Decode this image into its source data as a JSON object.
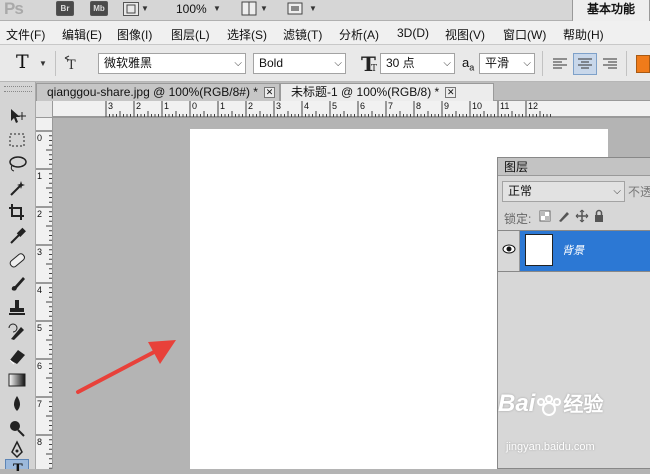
{
  "app": {
    "logo": "Ps",
    "bridge_label": "Br",
    "minibridge_label": "Mb",
    "zoom": "100%",
    "workspace": "基本功能"
  },
  "menu": [
    "文件(F)",
    "编辑(E)",
    "图像(I)",
    "图层(L)",
    "选择(S)",
    "滤镜(T)",
    "分析(A)",
    "3D(D)",
    "视图(V)",
    "窗口(W)",
    "帮助(H)"
  ],
  "options": {
    "tool_glyph": "T",
    "font_family": "微软雅黑",
    "font_style": "Bold",
    "font_size": "30 点",
    "aa_label": "a",
    "aa_sub": "a",
    "antialias": "平滑"
  },
  "tabs": [
    {
      "label": "qianggou-share.jpg @ 100%(RGB/8#) *",
      "active": false
    },
    {
      "label": "未标题-1 @ 100%(RGB/8) *",
      "active": true
    }
  ],
  "ruler_top": [
    "3",
    "2",
    "1",
    "0",
    "1",
    "2",
    "3",
    "4",
    "5",
    "6",
    "7",
    "8",
    "9",
    "10",
    "11",
    "12"
  ],
  "ruler_left": [
    "0",
    "1",
    "2",
    "3",
    "4",
    "5",
    "6",
    "7",
    "8"
  ],
  "layers": {
    "title": "图层",
    "blend_mode": "正常",
    "opacity_label": "不透",
    "lock_label": "锁定:",
    "layer_name": "背景"
  },
  "watermark": {
    "brand": "Bai",
    "brand2": "经验",
    "url": "jingyan.baidu.com"
  },
  "colors": {
    "accent": "#2c78d4",
    "arrow": "#e8413a",
    "orange_swatch": "#f07b1a"
  }
}
